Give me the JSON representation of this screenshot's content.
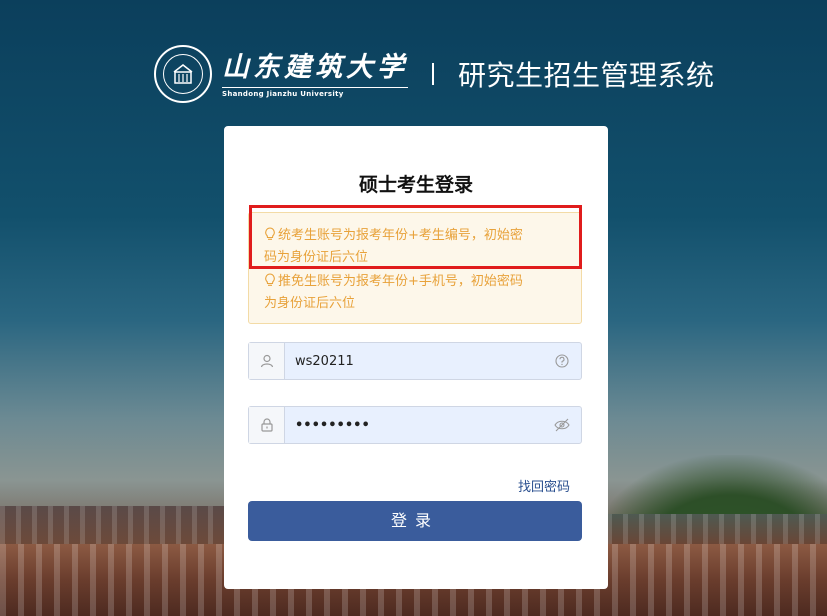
{
  "header": {
    "university_name": "山东建筑大学",
    "university_en": "Shandong Jianzhu University",
    "system_name": "研究生招生管理系统"
  },
  "login": {
    "title": "硕士考生登录",
    "notices": [
      "统考生账号为报考年份+考生编号，初始密码为身份证后六位",
      "推免生账号为报考年份+手机号，初始密码为身份证后六位"
    ],
    "notice_lines": [
      "统考生账号为报考年份+考生编号，初始密",
      "码为身份证后六位",
      "推免生账号为报考年份+手机号，初始密码",
      "为身份证后六位"
    ],
    "username_value": "ws20211",
    "password_value": "•••••••••",
    "forgot_label": "找回密码",
    "submit_label": "登录"
  },
  "icons": {
    "notice": "lightbulb-icon",
    "username": "user-icon",
    "username_help": "question-circle-icon",
    "password": "lock-icon",
    "password_toggle": "eye-off-icon"
  },
  "colors": {
    "primary_button": "#3a5c9c",
    "notice_text": "#e8a23a",
    "notice_bg": "#fdf7ea",
    "highlight_box": "#e01c1c",
    "link": "#2a4f8f"
  }
}
